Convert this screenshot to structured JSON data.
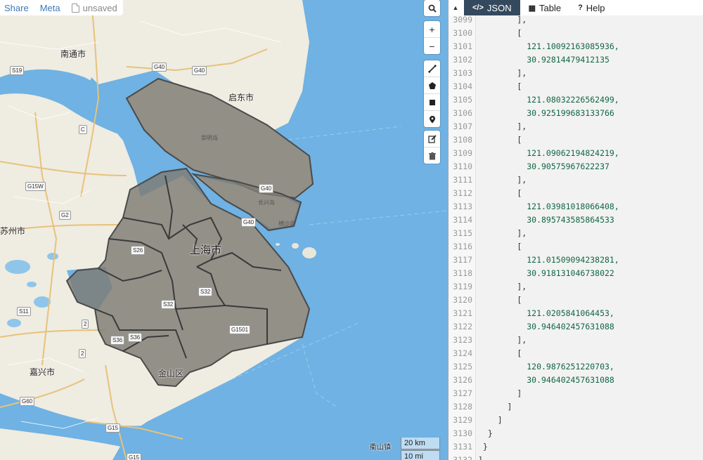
{
  "topbar": {
    "share_label": "Share",
    "meta_label": "Meta",
    "unsaved_label": "unsaved"
  },
  "map": {
    "labels": {
      "nantong": "南通市",
      "qidong": "启东市",
      "suzhou": "苏州市",
      "shanghai": "上海市",
      "jiaxing": "嘉兴市",
      "jinshan": "金山区",
      "chongming": "崇明岛",
      "changxing": "长兴岛",
      "hengsha": "横沙岛",
      "hengshanzhen": "衢山镇"
    },
    "shields": [
      "S19",
      "G40",
      "G40",
      "G15W",
      "G2",
      "S26",
      "S11",
      "S32",
      "S32",
      "S36",
      "S36",
      "G1501",
      "G60",
      "G15",
      "G15",
      "G40",
      "G40",
      "2",
      "2",
      "C"
    ],
    "controls": {
      "search_icon": "search-icon",
      "zoom_in": "+",
      "zoom_out": "−",
      "draw_tools": [
        "draw-line-icon",
        "draw-polygon-icon",
        "draw-rectangle-icon",
        "draw-marker-icon"
      ],
      "edit_tools": [
        "edit-icon",
        "trash-icon"
      ]
    },
    "scale": {
      "metric": "20 km",
      "imperial": "10 mi"
    },
    "colors": {
      "water": "#6fb2e3",
      "land": "#f0ede3",
      "polygon_fill": "#7f7b74",
      "polygon_stroke": "#4a4a4a"
    }
  },
  "panel": {
    "toggle_icon": "▲",
    "tabs": [
      {
        "icon": "</>",
        "label": "JSON",
        "active": true
      },
      {
        "icon": "▦",
        "label": "Table",
        "active": false
      },
      {
        "icon": "?",
        "label": "Help",
        "active": false
      }
    ],
    "lines": [
      {
        "n": "3099",
        "text": "        ],"
      },
      {
        "n": "3100",
        "text": "        ["
      },
      {
        "n": "3101",
        "text": "          121.10092163085936,",
        "num": true
      },
      {
        "n": "3102",
        "text": "          30.92814479412135",
        "num": true
      },
      {
        "n": "3103",
        "text": "        ],"
      },
      {
        "n": "3104",
        "text": "        ["
      },
      {
        "n": "3105",
        "text": "          121.08032226562499,",
        "num": true
      },
      {
        "n": "3106",
        "text": "          30.925199683133766",
        "num": true
      },
      {
        "n": "3107",
        "text": "        ],"
      },
      {
        "n": "3108",
        "text": "        ["
      },
      {
        "n": "3109",
        "text": "          121.09062194824219,",
        "num": true
      },
      {
        "n": "3110",
        "text": "          30.90575967622237",
        "num": true
      },
      {
        "n": "3111",
        "text": "        ],"
      },
      {
        "n": "3112",
        "text": "        ["
      },
      {
        "n": "3113",
        "text": "          121.03981018066408,",
        "num": true
      },
      {
        "n": "3114",
        "text": "          30.895743585864533",
        "num": true
      },
      {
        "n": "3115",
        "text": "        ],"
      },
      {
        "n": "3116",
        "text": "        ["
      },
      {
        "n": "3117",
        "text": "          121.01509094238281,",
        "num": true
      },
      {
        "n": "3118",
        "text": "          30.918131046738022",
        "num": true
      },
      {
        "n": "3119",
        "text": "        ],"
      },
      {
        "n": "3120",
        "text": "        ["
      },
      {
        "n": "3121",
        "text": "          121.0205841064453,",
        "num": true
      },
      {
        "n": "3122",
        "text": "          30.946402457631088",
        "num": true
      },
      {
        "n": "3123",
        "text": "        ],"
      },
      {
        "n": "3124",
        "text": "        ["
      },
      {
        "n": "3125",
        "text": "          120.9876251220703,",
        "num": true
      },
      {
        "n": "3126",
        "text": "          30.946402457631088",
        "num": true
      },
      {
        "n": "3127",
        "text": "        ]"
      },
      {
        "n": "3128",
        "text": "      ]"
      },
      {
        "n": "3129",
        "text": "    ]"
      },
      {
        "n": "3130",
        "text": "  }"
      },
      {
        "n": "3131",
        "text": " }"
      },
      {
        "n": "3132",
        "text": "]"
      }
    ]
  }
}
